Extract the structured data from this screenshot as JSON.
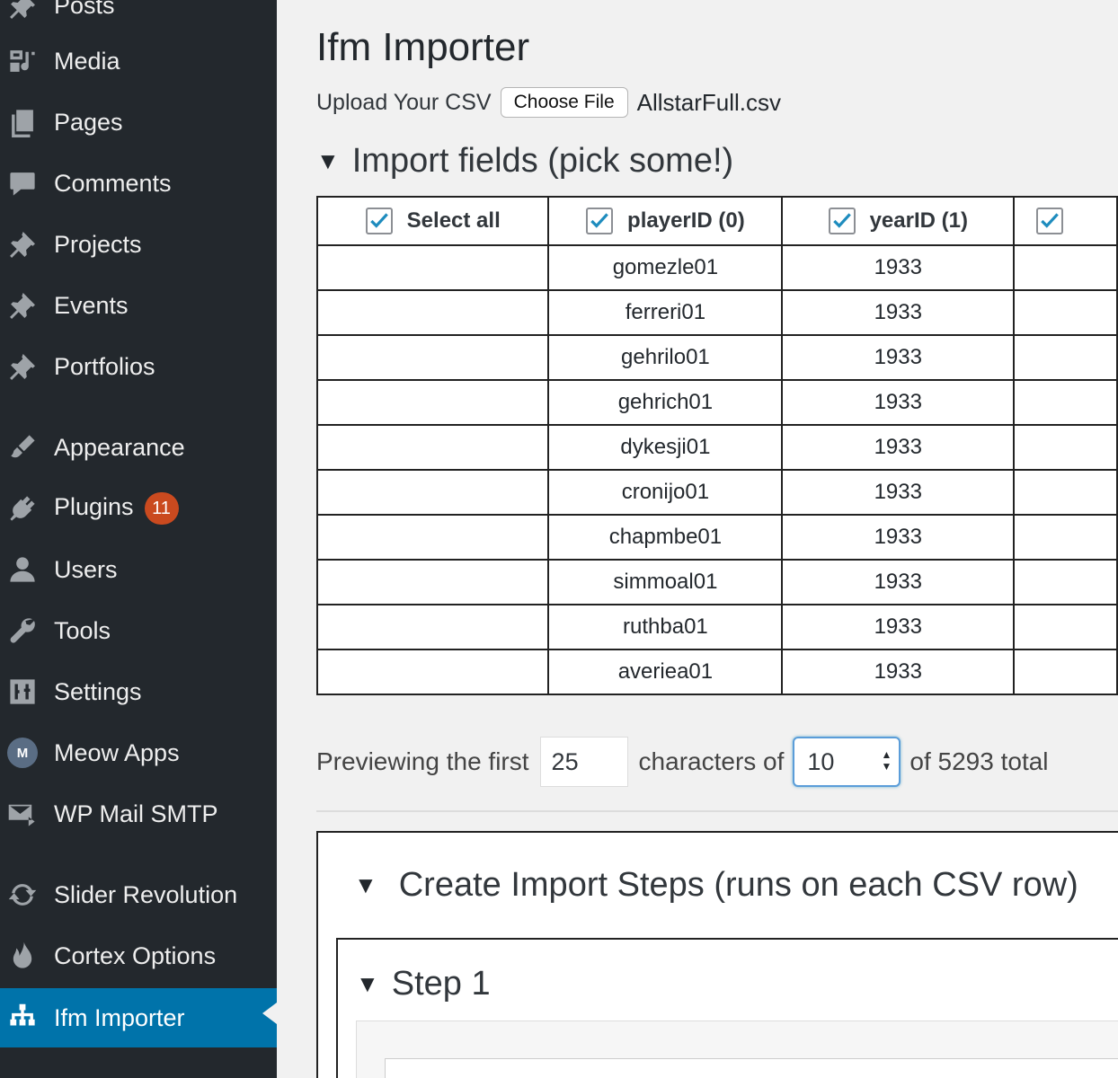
{
  "sidebar": {
    "items": [
      {
        "label": "Posts",
        "icon": "pin-icon"
      },
      {
        "label": "Media",
        "icon": "media-icon"
      },
      {
        "label": "Pages",
        "icon": "pages-icon"
      },
      {
        "label": "Comments",
        "icon": "comment-icon"
      },
      {
        "label": "Projects",
        "icon": "pin-icon"
      },
      {
        "label": "Events",
        "icon": "pin-icon"
      },
      {
        "label": "Portfolios",
        "icon": "pin-icon"
      },
      {
        "label": "Appearance",
        "icon": "brush-icon"
      },
      {
        "label": "Plugins",
        "icon": "plug-icon",
        "badge": "11"
      },
      {
        "label": "Users",
        "icon": "user-icon"
      },
      {
        "label": "Tools",
        "icon": "wrench-icon"
      },
      {
        "label": "Settings",
        "icon": "sliders-icon"
      },
      {
        "label": "Meow Apps",
        "icon": "meow-icon",
        "icon_text": "M"
      },
      {
        "label": "WP Mail SMTP",
        "icon": "mail-icon"
      },
      {
        "label": "Slider Revolution",
        "icon": "refresh-icon"
      },
      {
        "label": "Cortex Options",
        "icon": "flame-icon"
      },
      {
        "label": "Ifm Importer",
        "icon": "sitemap-icon",
        "active": true
      }
    ],
    "colors": {
      "bg": "#23282d",
      "active": "#0073aa",
      "badge": "#ca4a1f"
    }
  },
  "main": {
    "title": "Ifm Importer",
    "upload": {
      "label": "Upload Your CSV",
      "button": "Choose File",
      "file_name": "AllstarFull.csv"
    },
    "fields_section": {
      "title": "Import fields (pick some!)",
      "headers": [
        "Select all",
        "playerID (0)",
        "yearID (1)"
      ],
      "rows": [
        [
          "",
          "gomezle01",
          "1933"
        ],
        [
          "",
          "ferreri01",
          "1933"
        ],
        [
          "",
          "gehrilo01",
          "1933"
        ],
        [
          "",
          "gehrich01",
          "1933"
        ],
        [
          "",
          "dykesji01",
          "1933"
        ],
        [
          "",
          "cronijo01",
          "1933"
        ],
        [
          "",
          "chapmbe01",
          "1933"
        ],
        [
          "",
          "simmoal01",
          "1933"
        ],
        [
          "",
          "ruthba01",
          "1933"
        ],
        [
          "",
          "averiea01",
          "1933"
        ]
      ]
    },
    "preview": {
      "prefix": "Previewing the first",
      "chars_value": "25",
      "middle": "characters of",
      "rows_value": "10",
      "suffix": "of 5293 total"
    },
    "steps_section": {
      "title": "Create Import Steps (runs on each CSV row)"
    },
    "step": {
      "title": "Step 1"
    }
  }
}
